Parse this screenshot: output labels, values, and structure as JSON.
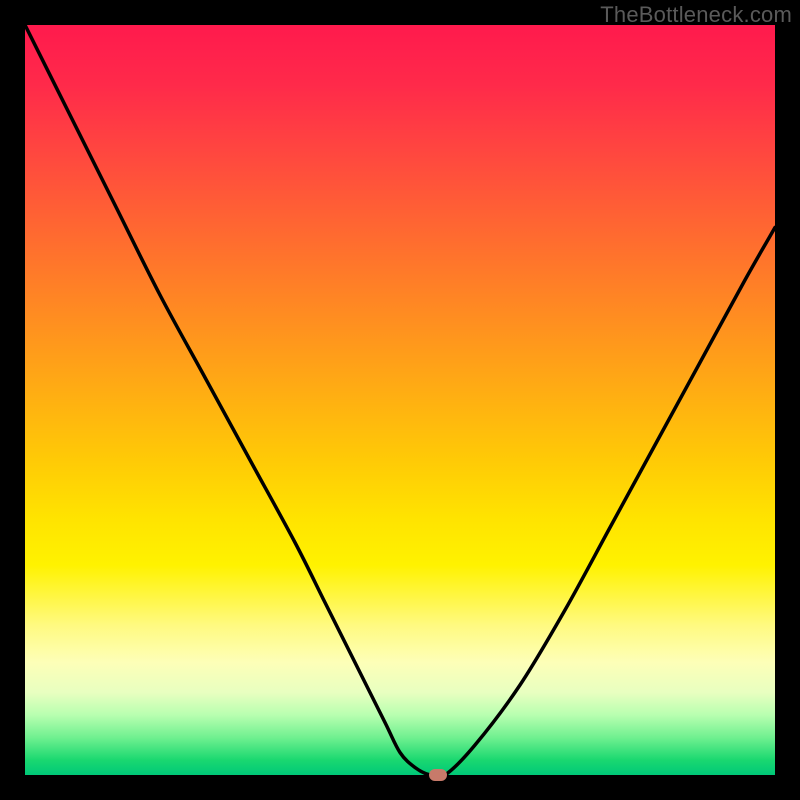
{
  "watermark": "TheBottleneck.com",
  "chart_data": {
    "type": "line",
    "title": "",
    "xlabel": "",
    "ylabel": "",
    "xlim": [
      0,
      100
    ],
    "ylim": [
      0,
      100
    ],
    "grid": false,
    "legend": false,
    "series": [
      {
        "name": "bottleneck-curve",
        "x": [
          0,
          6,
          12,
          18,
          24,
          30,
          36,
          40,
          44,
          48,
          50,
          52,
          54,
          56,
          60,
          66,
          72,
          78,
          84,
          90,
          96,
          100
        ],
        "values": [
          100,
          88,
          76,
          64,
          53,
          42,
          31,
          23,
          15,
          7,
          3,
          1,
          0,
          0,
          4,
          12,
          22,
          33,
          44,
          55,
          66,
          73
        ]
      }
    ],
    "marker": {
      "x": 55,
      "y": 0,
      "color": "#c77a6a"
    },
    "gradient_stops": [
      {
        "pos": 0,
        "color": "#ff1a4d"
      },
      {
        "pos": 50,
        "color": "#ffca06"
      },
      {
        "pos": 75,
        "color": "#fff200"
      },
      {
        "pos": 100,
        "color": "#00c878"
      }
    ]
  }
}
